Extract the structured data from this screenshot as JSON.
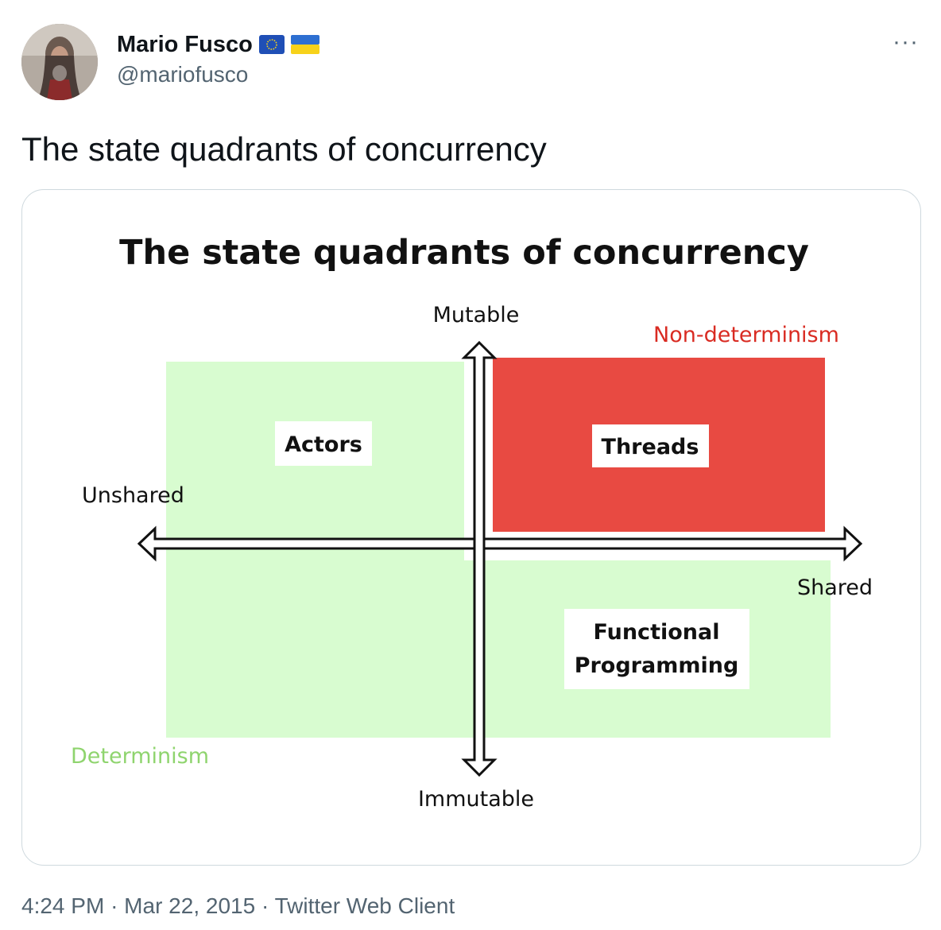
{
  "author": {
    "name": "Mario Fusco",
    "handle": "@mariofusco",
    "flags": [
      "eu-flag-icon",
      "ukraine-flag-icon"
    ]
  },
  "more_label": "···",
  "tweet_text": "The state quadrants of concurrency",
  "figure": {
    "title": "The state quadrants of concurrency",
    "axes": {
      "top": "Mutable",
      "bottom": "Immutable",
      "left": "Unshared",
      "right": "Shared"
    },
    "quadrants": {
      "top_left": "Actors",
      "top_right": "Threads",
      "bottom_right_line1": "Functional",
      "bottom_right_line2": "Programming"
    },
    "legend": {
      "non_determinism": "Non-determinism",
      "determinism": "Determinism"
    },
    "colors": {
      "determinism_fill": "#d8fcd0",
      "non_determinism_fill": "#e84a42",
      "non_determinism_text": "#d92b22",
      "determinism_text": "#8fd46e"
    }
  },
  "meta": {
    "time": "4:24 PM",
    "date": "Mar 22, 2015",
    "client": "Twitter Web Client",
    "separator": "·"
  }
}
